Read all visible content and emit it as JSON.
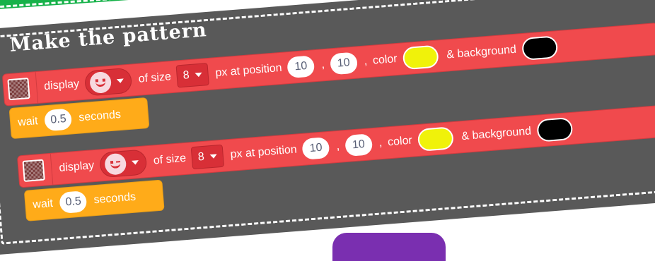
{
  "heading": {
    "title": "Make the pattern"
  },
  "blocks": [
    {
      "display_label": "display",
      "face": "smiley-face",
      "of_size_label": "of size",
      "size": "8",
      "px_label": "px at position",
      "x": "10",
      "y": "10",
      "comma": ",",
      "comma2": ",",
      "color_label": "color",
      "color_swatch": "#f0f20a",
      "background_label": "& background",
      "background_swatch": "#000000"
    },
    {
      "display_label": "display",
      "face": "winking-face",
      "of_size_label": "of size",
      "size": "8",
      "px_label": "px at position",
      "x": "10",
      "y": "10",
      "comma": ",",
      "comma2": ",",
      "color_label": "color",
      "color_swatch": "#f0f20a",
      "background_label": "& background",
      "background_swatch": "#000000"
    }
  ],
  "waits": [
    {
      "label": "wait",
      "value": "0.5",
      "unit": "seconds"
    },
    {
      "label": "wait",
      "value": "0.5",
      "unit": "seconds"
    }
  ],
  "colors": {
    "card": "#595959",
    "red_block": "#f04a4d",
    "wait_block": "#ffab19",
    "green_strip": "#17b24a",
    "purple_tab": "#7a2fb0"
  }
}
